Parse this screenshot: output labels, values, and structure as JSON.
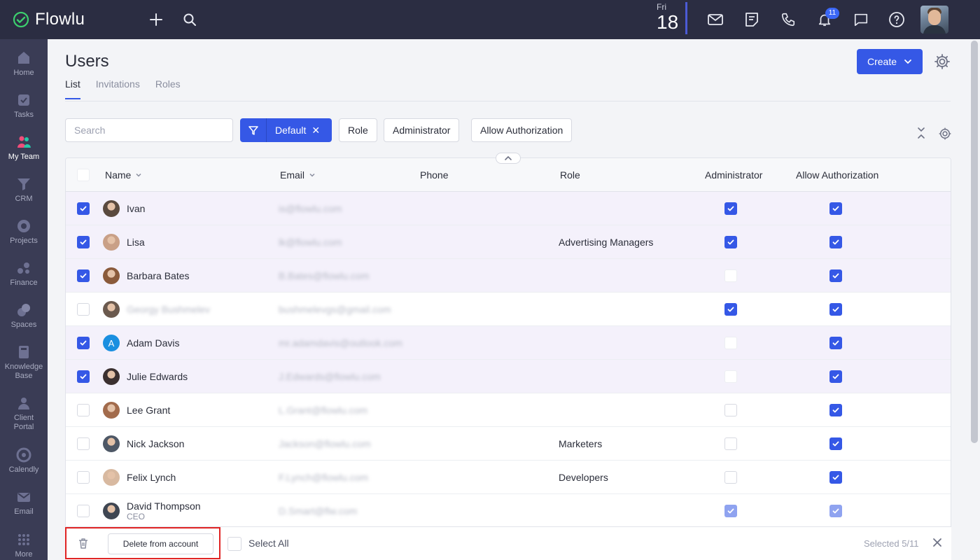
{
  "app": {
    "name": "Flowlu"
  },
  "topbar": {
    "date_day": "Fri",
    "date_num": "18",
    "notifications_count": "11",
    "icons": [
      "add-icon",
      "search-icon",
      "mail-icon",
      "notes-icon",
      "phone-icon",
      "bell-icon",
      "chat-icon",
      "help-icon"
    ]
  },
  "sidebar": {
    "items": [
      {
        "label": "Home",
        "icon": "home-icon"
      },
      {
        "label": "Tasks",
        "icon": "tasks-icon"
      },
      {
        "label": "My Team",
        "icon": "team-icon",
        "active": true
      },
      {
        "label": "CRM",
        "icon": "crm-icon"
      },
      {
        "label": "Projects",
        "icon": "projects-icon"
      },
      {
        "label": "Finance",
        "icon": "finance-icon"
      },
      {
        "label": "Spaces",
        "icon": "spaces-icon"
      },
      {
        "label": "Knowledge",
        "label2": "Base",
        "icon": "knowledge-base-icon"
      },
      {
        "label": "Client",
        "label2": "Portal",
        "icon": "client-portal-icon"
      },
      {
        "label": "Calendly",
        "icon": "calendly-icon"
      },
      {
        "label": "Email",
        "icon": "email-icon"
      },
      {
        "label": "More",
        "icon": "more-grid-icon"
      }
    ]
  },
  "page": {
    "title": "Users",
    "tabs": [
      "List",
      "Invitations",
      "Roles"
    ],
    "active_tab": "List",
    "create_label": "Create"
  },
  "filters": {
    "search_placeholder": "Search",
    "active_filter": "Default",
    "chips": [
      "Role",
      "Administrator",
      "Allow Authorization"
    ]
  },
  "table": {
    "columns": [
      "Name",
      "Email",
      "Phone",
      "Role",
      "Administrator",
      "Allow Authorization"
    ],
    "rows": [
      {
        "selected": true,
        "name": "Ivan",
        "position": "",
        "email": "is@flowlu.com",
        "role": "",
        "admin": "on",
        "auth": "on",
        "avatar": "#5a4a3e",
        "blur_name": false
      },
      {
        "selected": true,
        "name": "Lisa",
        "position": "",
        "email": "lk@flowlu.com",
        "role": "Advertising Managers",
        "admin": "on",
        "auth": "on",
        "avatar": "#c9a087",
        "blur_name": false
      },
      {
        "selected": true,
        "name": "Barbara Bates",
        "position": "",
        "email": "B.Bates@flowlu.com",
        "role": "",
        "admin": "faint",
        "auth": "on",
        "avatar": "#8a5a3b",
        "blur_name": false
      },
      {
        "selected": false,
        "name": "Georgy Bushmelev",
        "position": "",
        "email": "bushmelevgs@gmail.com",
        "role": "",
        "admin": "on",
        "auth": "on",
        "avatar": "#6b5a4e",
        "blur_name": true
      },
      {
        "selected": true,
        "name": "Adam Davis",
        "position": "",
        "email": "mr.adamdavis@outlook.com",
        "role": "",
        "admin": "faint",
        "auth": "on",
        "avatar": "letter",
        "letter": "A",
        "blur_name": false
      },
      {
        "selected": true,
        "name": "Julie Edwards",
        "position": "",
        "email": "J.Edwards@flowlu.com",
        "role": "",
        "admin": "faint",
        "auth": "on",
        "avatar": "#3b3030",
        "blur_name": false
      },
      {
        "selected": false,
        "name": "Lee Grant",
        "position": "",
        "email": "L.Grant@flowlu.com",
        "role": "",
        "admin": "off",
        "auth": "on",
        "avatar": "#a26b4c",
        "blur_name": false
      },
      {
        "selected": false,
        "name": "Nick Jackson",
        "position": "",
        "email": "Jackson@flowlu.com",
        "role": "Marketers",
        "admin": "off",
        "auth": "on",
        "avatar": "#4e5866",
        "blur_name": false
      },
      {
        "selected": false,
        "name": "Felix Lynch",
        "position": "",
        "email": "F.Lynch@flowlu.com",
        "role": "Developers",
        "admin": "off",
        "auth": "on",
        "avatar": "#d8b9a0",
        "blur_name": false
      },
      {
        "selected": false,
        "name": "David Thompson",
        "position": "CEO",
        "email": "D.Smart@flw.com",
        "role": "",
        "admin": "dis",
        "auth": "dis",
        "avatar": "#3f4652",
        "blur_name": false
      }
    ]
  },
  "bottom_bar": {
    "delete_label": "Delete from account",
    "select_all_label": "Select All",
    "selected_label": "Selected 5/11"
  },
  "colors": {
    "accent": "#3558e6",
    "topbar": "#2b2d42",
    "sidebar": "#3a3c55",
    "highlight": "#e02424"
  }
}
